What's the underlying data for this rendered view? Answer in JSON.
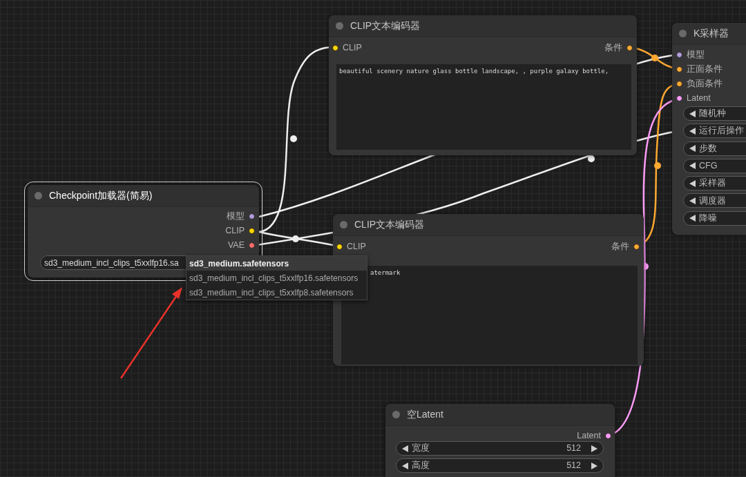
{
  "nodes": [
    {
      "kind": "text_encoder",
      "title": "CLIP文本编码器",
      "selected": false,
      "inputs": [
        {
          "label": "CLIP",
          "color": "#ffd500"
        }
      ],
      "outputs": [
        {
          "label": "条件",
          "color": "#ffa931"
        }
      ],
      "prompt": "beautiful scenery nature glass bottle landscape, , purple galaxy bottle,"
    },
    {
      "kind": "sampler",
      "title": "K采样器",
      "selected": false,
      "inputs": [
        {
          "label": "模型",
          "color": "#b39ddb"
        },
        {
          "label": "正面条件",
          "color": "#ffa931"
        },
        {
          "label": "负面条件",
          "color": "#ffa931"
        },
        {
          "label": "Latent",
          "color": "#ff9cf9"
        }
      ],
      "widgets": [
        {
          "label": "随机种"
        },
        {
          "label": "运行后操作"
        },
        {
          "label": "步数"
        },
        {
          "label": "CFG"
        },
        {
          "label": "采样器"
        },
        {
          "label": "调度器"
        },
        {
          "label": "降噪"
        }
      ]
    },
    {
      "kind": "loader",
      "title": "Checkpoint加载器(简易)",
      "selected": true,
      "outputs": [
        {
          "label": "模型",
          "color": "#b39ddb"
        },
        {
          "label": "CLIP",
          "color": "#ffd500"
        },
        {
          "label": "VAE",
          "color": "#ff6e6e"
        }
      ],
      "combo": {
        "value": "sd3_medium_incl_clips_t5xxlfp16.sa"
      }
    },
    {
      "kind": "text_encoder",
      "title": "CLIP文本编码器",
      "selected": false,
      "inputs": [
        {
          "label": "CLIP",
          "color": "#ffd500"
        }
      ],
      "outputs": [
        {
          "label": "条件",
          "color": "#ffa931"
        }
      ],
      "prompt": "atermark"
    },
    {
      "kind": "latent",
      "title": "空Latent",
      "selected": false,
      "outputs": [
        {
          "label": "Latent",
          "color": "#ff9cf9"
        }
      ],
      "widgets": [
        {
          "label": "宽度",
          "value": "512"
        },
        {
          "label": "高度",
          "value": "512"
        }
      ]
    }
  ],
  "dropdown": {
    "items": [
      {
        "label": "sd3_medium.safetensors",
        "selected": true
      },
      {
        "label": "sd3_medium_incl_clips_t5xxlfp16.safetensors",
        "selected": false
      },
      {
        "label": "sd3_medium_incl_clips_t5xxlfp8.safetensors",
        "selected": false
      }
    ]
  }
}
